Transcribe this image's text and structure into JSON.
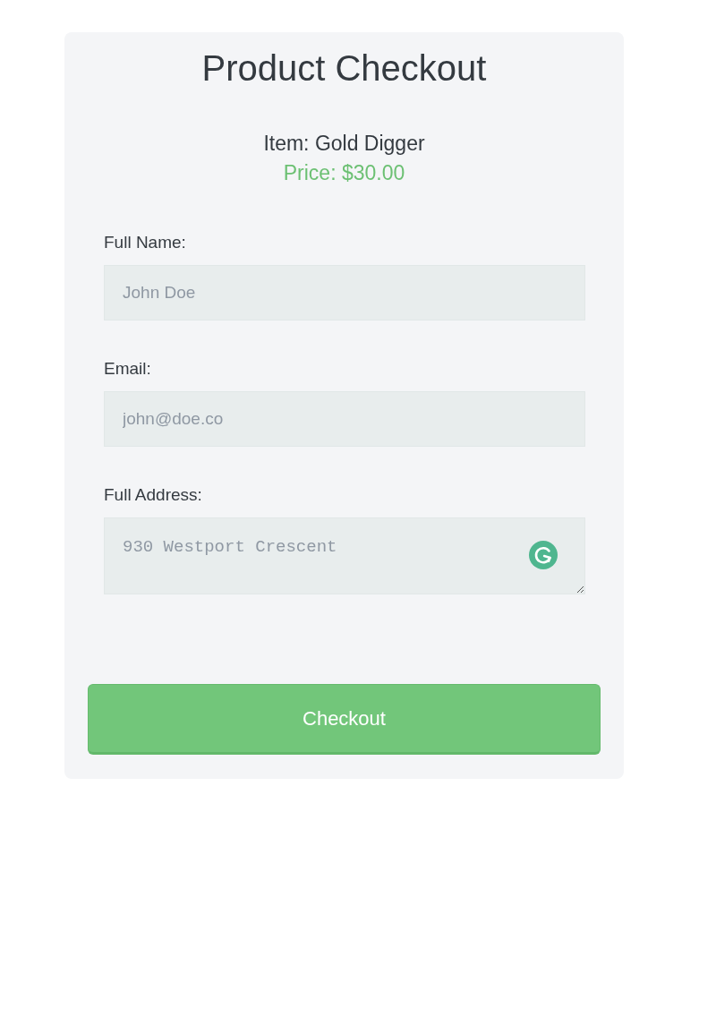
{
  "title": "Product Checkout",
  "product": {
    "item": "Item: Gold Digger",
    "price": "Price: $30.00"
  },
  "fields": [
    {
      "kind": "input",
      "label": "Full Name:",
      "placeholder": "John Doe"
    },
    {
      "kind": "input",
      "label": "Email:",
      "placeholder": "john@doe.co"
    },
    {
      "kind": "textarea",
      "label": "Full Address:",
      "placeholder": "930 Westport Crescent"
    }
  ],
  "submit_button": {
    "label": "Checkout"
  }
}
